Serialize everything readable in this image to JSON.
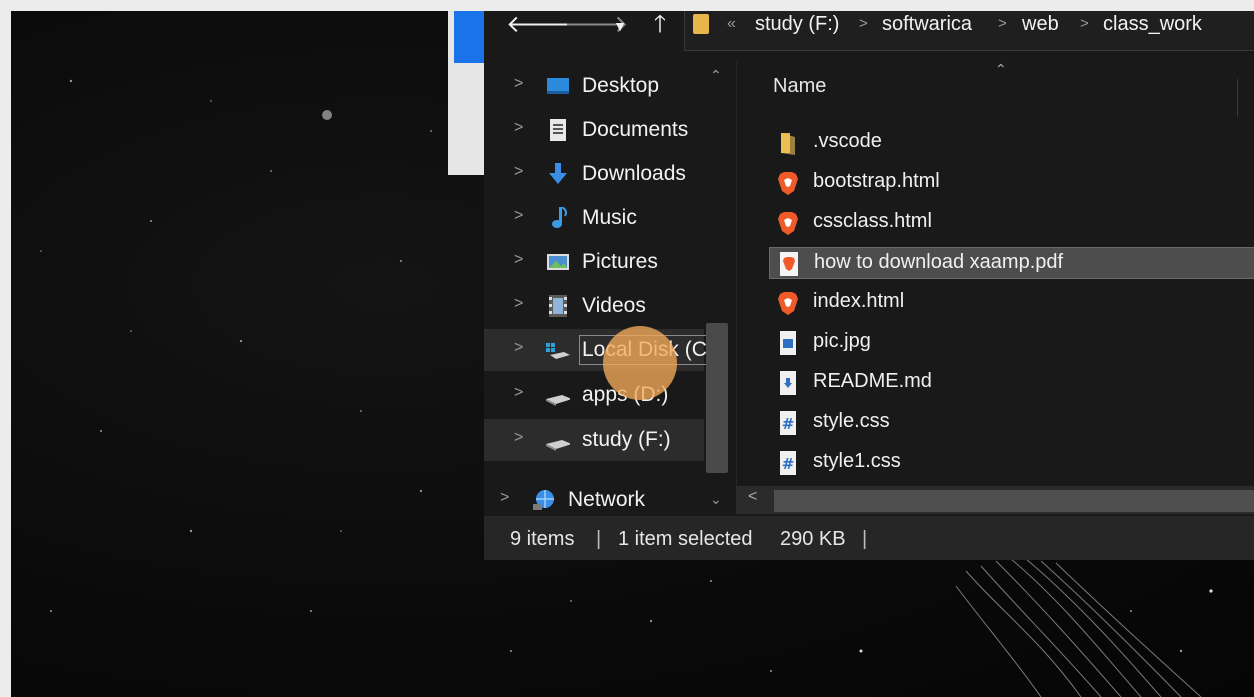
{
  "colors": {
    "background": "#0a0a0a",
    "explorer_bg": "#191919",
    "selected_row": "#4d4d4d",
    "folder": "#e8b54a",
    "brave_orange": "#f05a28",
    "highlight": "#f3aa5a"
  },
  "nav_buttons": {
    "back_icon": "arrow-left-icon",
    "forward_icon": "arrow-right-icon",
    "recent_icon": "chevron-down-icon",
    "up_icon": "arrow-up-icon"
  },
  "address": {
    "overflow": "«",
    "crumbs": [
      "study (F:)",
      "softwarica",
      "web",
      "class_work"
    ],
    "separator": ">"
  },
  "nav_pane": {
    "items": [
      {
        "label": "Desktop",
        "icon": "desktop-icon"
      },
      {
        "label": "Documents",
        "icon": "documents-icon"
      },
      {
        "label": "Downloads",
        "icon": "downloads-icon"
      },
      {
        "label": "Music",
        "icon": "music-icon"
      },
      {
        "label": "Pictures",
        "icon": "pictures-icon"
      },
      {
        "label": "Videos",
        "icon": "videos-icon"
      },
      {
        "label": "Local Disk (C:)",
        "icon": "windows-drive-icon"
      },
      {
        "label": "apps (D:)",
        "icon": "drive-icon"
      },
      {
        "label": "study (F:)",
        "icon": "drive-icon"
      },
      {
        "label": "Network",
        "icon": "network-icon"
      }
    ]
  },
  "content": {
    "column_name": "Name",
    "files": [
      {
        "name": ".vscode",
        "icon": "folder-icon"
      },
      {
        "name": "bootstrap.html",
        "icon": "brave-icon"
      },
      {
        "name": "cssclass.html",
        "icon": "brave-icon"
      },
      {
        "name": "how to download xaamp.pdf",
        "icon": "pdf-brave-icon",
        "selected": true
      },
      {
        "name": "index.html",
        "icon": "brave-icon"
      },
      {
        "name": "pic.jpg",
        "icon": "image-file-icon"
      },
      {
        "name": "README.md",
        "icon": "md-file-icon"
      },
      {
        "name": "style.css",
        "icon": "css-file-icon"
      },
      {
        "name": "style1.css",
        "icon": "css-file-icon"
      }
    ]
  },
  "status": {
    "items_count": "9 items",
    "selection": "1 item selected",
    "size": "290 KB",
    "separator": "|"
  }
}
